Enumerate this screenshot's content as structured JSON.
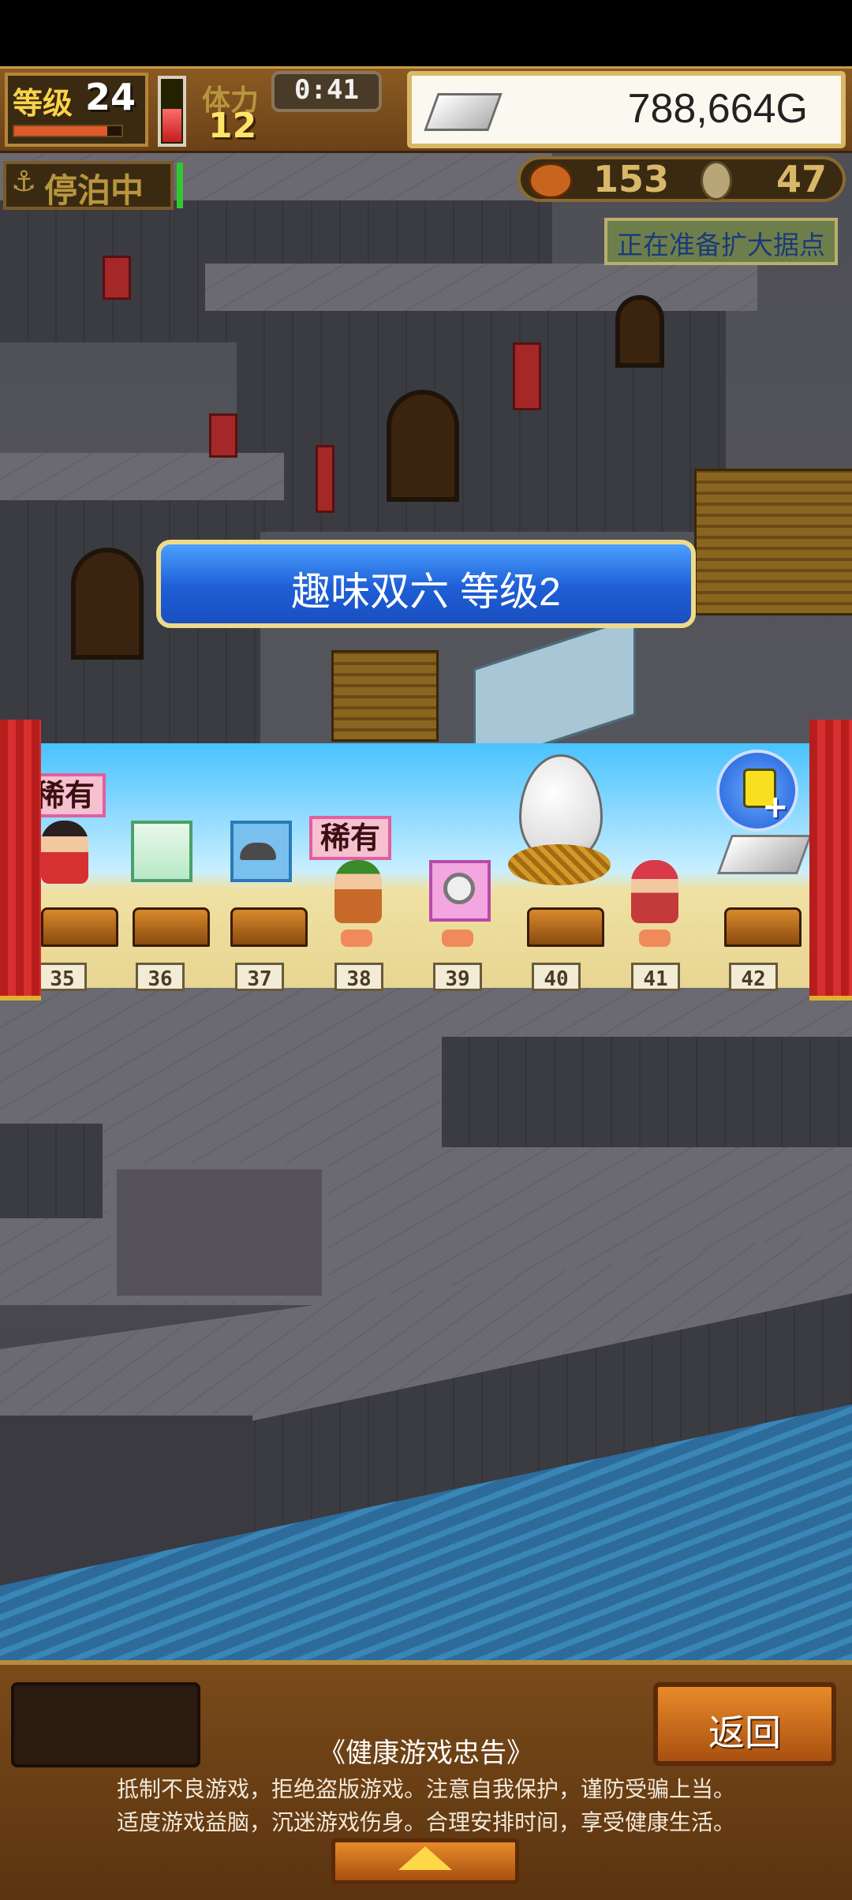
{
  "hud": {
    "level_label": "等级",
    "level_value": "24",
    "stamina_label": "体力",
    "stamina_value": "12",
    "timer": "0:41",
    "gold": "788,664G"
  },
  "status": {
    "anchor_label": "停泊中",
    "food_value": "153",
    "wood_value": "47",
    "expand_notice": "正在准备扩大据点"
  },
  "board": {
    "title": "趣味双六 等级2",
    "rare_label": "稀有",
    "squares": [
      "35",
      "36",
      "37",
      "38",
      "39",
      "40",
      "41",
      "42"
    ]
  },
  "bottom": {
    "back_label": "返回",
    "notice_title": "《健康游戏忠告》",
    "notice_line1": "抵制不良游戏，拒绝盗版游戏。注意自我保护，谨防受骗上当。",
    "notice_line2": "适度游戏益脑，沉迷游戏伤身。合理安排时间，享受健康生活。"
  },
  "colors": {
    "hud_wood": "#6b4217",
    "banner_blue": "#1e5ed6",
    "gold_text": "#ffe46a",
    "curtain_red": "#c41d1d"
  }
}
